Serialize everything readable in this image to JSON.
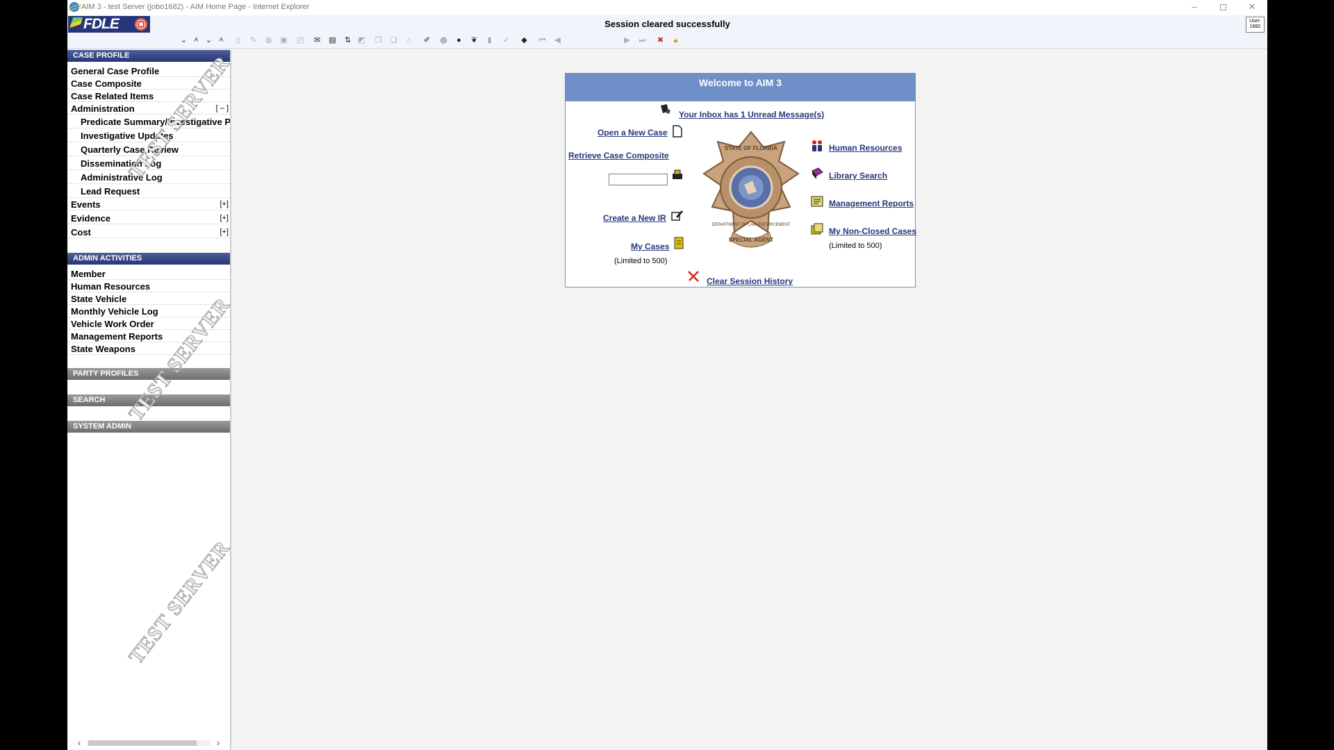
{
  "window": {
    "title": "AIM 3 - test Server (jobo1682) - AIM Home Page - Internet Explorer",
    "controls": {
      "minimize": "–",
      "close": "✕"
    }
  },
  "header": {
    "logo_text": "FDLE",
    "status_message": "Session cleared successfully",
    "user_label": "User:",
    "user_id": "1682"
  },
  "toolbar": {
    "icons": [
      "collapse-all-icon",
      "collapse-icon",
      "expand-all-icon",
      "expand-icon",
      "new-doc-icon",
      "edit-icon",
      "delete-icon",
      "save-icon",
      "print-preview-icon",
      "inbox-icon",
      "printer-icon",
      "transfer-icon",
      "view-icon",
      "copy-icon",
      "paste-icon",
      "attach-icon",
      "edit-pencil-icon",
      "search-binoculars-icon",
      "library-icon",
      "report-icon",
      "export-icon",
      "spell-icon",
      "book-icon",
      "first-record-icon",
      "prev-record-icon",
      "next-record-icon",
      "last-record-icon",
      "close-record-icon",
      "lock-icon"
    ]
  },
  "sidebar": {
    "case_profile": {
      "heading": "CASE PROFILE",
      "items": [
        {
          "label": "General Case Profile"
        },
        {
          "label": "Case Composite"
        },
        {
          "label": "Case Related Items"
        },
        {
          "label": "Administration",
          "toggle": "[ – ]"
        }
      ],
      "admin_subitems": [
        {
          "label": "Predicate Summary/Investigative Plan"
        },
        {
          "label": "Investigative Updates"
        },
        {
          "label": "Quarterly Case Review"
        },
        {
          "label": "Dissemination Log"
        },
        {
          "label": "Administrative Log"
        },
        {
          "label": "Lead Request"
        }
      ],
      "more_items": [
        {
          "label": "Events",
          "toggle": "[+]"
        },
        {
          "label": "Evidence",
          "toggle": "[+]"
        },
        {
          "label": "Cost",
          "toggle": "[+]"
        }
      ]
    },
    "admin_activities": {
      "heading": "ADMIN ACTIVITIES",
      "items": [
        {
          "label": "Member"
        },
        {
          "label": "Human Resources"
        },
        {
          "label": "State Vehicle"
        },
        {
          "label": "Monthly Vehicle Log"
        },
        {
          "label": "Vehicle Work Order"
        },
        {
          "label": "Management Reports"
        },
        {
          "label": "State Weapons"
        }
      ]
    },
    "party_profiles": {
      "heading": "PARTY PROFILES"
    },
    "search": {
      "heading": "SEARCH"
    },
    "system_admin": {
      "heading": "SYSTEM ADMIN"
    },
    "watermark": "TEST SERVER"
  },
  "welcome": {
    "title": "Welcome to AIM 3",
    "inbox_link": "Your Inbox has 1 Unread Message(s)",
    "open_case_link": "Open a New Case",
    "retrieve_link": "Retrieve Case Composite",
    "case_number_value": "",
    "create_ir_link": "Create a New IR",
    "my_cases_link": "My Cases",
    "my_cases_note": "(Limited to 500)",
    "human_resources_link": "Human Resources",
    "library_search_link": "Library Search",
    "management_reports_link": "Management Reports",
    "non_closed_link": "My Non-Closed Cases",
    "non_closed_note": "(Limited to 500)",
    "clear_history_link": "Clear Session History",
    "badge_text_top": "STATE OF FLORIDA",
    "badge_text_ring": "DEPARTMENT OF LAW ENFORCEMENT",
    "badge_text_bottom": "SPECIAL AGENT"
  }
}
